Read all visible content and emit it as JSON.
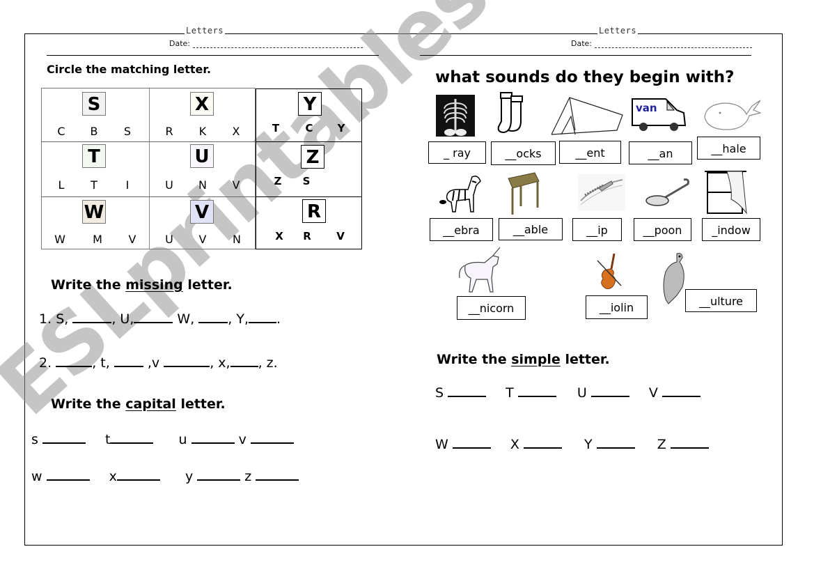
{
  "left_page": {
    "header": {
      "title": "Letters",
      "date_label": "Date:"
    },
    "circle_section": {
      "heading": "Circle the matching letter.",
      "cells": [
        {
          "target": "S",
          "options": [
            "C",
            "B",
            "S"
          ],
          "target_bg": "#f2f2f2"
        },
        {
          "target": "X",
          "options": [
            "R",
            "K",
            "X"
          ],
          "target_bg": "#fbfbf3"
        },
        {
          "target": "Y",
          "options": [
            "T",
            "C",
            "Y"
          ],
          "target_bg": "#ffffff"
        },
        {
          "target": "T",
          "options": [
            "L",
            "T",
            "I"
          ],
          "target_bg": "#f3f9f1"
        },
        {
          "target": "U",
          "options": [
            "U",
            "N",
            "V"
          ],
          "target_bg": "#f8f6fc"
        },
        {
          "target": "Z",
          "options": [
            "Z",
            "S"
          ],
          "target_bg": "#ffffff"
        },
        {
          "target": "W",
          "options": [
            "W",
            "M",
            "V"
          ],
          "target_bg": "#f2ebe2"
        },
        {
          "target": "V",
          "options": [
            "U",
            "V",
            "N"
          ],
          "target_bg": "#e0e2f8"
        },
        {
          "target": "R",
          "options": [
            "X",
            "R",
            "V"
          ],
          "target_bg": "#ffffff"
        }
      ]
    },
    "missing_section": {
      "heading_pre": "Write the ",
      "heading_underlined": "missing",
      "heading_post": " letter.",
      "line1": {
        "num": "1.",
        "parts": [
          "S,",
          ", U,",
          "W,",
          ", Y,",
          "."
        ]
      },
      "line2": {
        "num": "2.",
        "parts": [
          "",
          ", t,",
          ",v",
          ", x,",
          ", z."
        ]
      }
    },
    "capital_section": {
      "heading_pre": "Write the ",
      "heading_underlined": "capital",
      "heading_post": " letter.",
      "row1": [
        "s",
        "t",
        "u",
        "v"
      ],
      "row2": [
        "w",
        "x",
        "y",
        "z"
      ]
    }
  },
  "right_page": {
    "header": {
      "title": "Letters",
      "date_label": "Date:"
    },
    "sounds_section": {
      "heading": "what sounds do they begin with?",
      "van_label": "van",
      "items": [
        {
          "picture": "x-ray",
          "word": "_ ray"
        },
        {
          "picture": "socks",
          "word": "__ocks"
        },
        {
          "picture": "tent",
          "word": "__ent"
        },
        {
          "picture": "van",
          "word": "__an"
        },
        {
          "picture": "whale",
          "word": "__hale"
        },
        {
          "picture": "zebra",
          "word": "__ebra"
        },
        {
          "picture": "table",
          "word": "__able"
        },
        {
          "picture": "zip",
          "word": "__ip"
        },
        {
          "picture": "spoon",
          "word": "__poon"
        },
        {
          "picture": "window",
          "word": "_indow"
        },
        {
          "picture": "unicorn",
          "word": "__nicorn"
        },
        {
          "picture": "violin",
          "word": "__iolin"
        },
        {
          "picture": "vulture",
          "word": "__ulture"
        }
      ]
    },
    "simple_section": {
      "heading_pre": "Write the ",
      "heading_underlined": "simple",
      "heading_post": " letter.",
      "row1": [
        "S",
        "T",
        "U",
        "V"
      ],
      "row2": [
        "W",
        "X",
        "Y",
        "Z"
      ]
    }
  },
  "watermark": "ESLprintables.com"
}
